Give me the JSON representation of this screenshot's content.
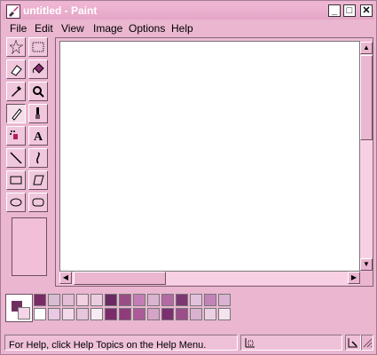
{
  "window": {
    "title": "untitled - Paint",
    "buttons": {
      "minimize": "_",
      "maximize": "□",
      "close": "✕"
    }
  },
  "menu": [
    "File",
    "Edit",
    "View",
    "Image",
    "Options",
    "Help"
  ],
  "tools": [
    {
      "name": "free-form-select-tool",
      "icon": "star-select-icon"
    },
    {
      "name": "select-tool",
      "icon": "rectangle-select-icon"
    },
    {
      "name": "eraser-tool",
      "icon": "eraser-icon"
    },
    {
      "name": "fill-tool",
      "icon": "paint-bucket-icon"
    },
    {
      "name": "pick-color-tool",
      "icon": "eyedropper-icon"
    },
    {
      "name": "magnifier-tool",
      "icon": "magnifier-icon"
    },
    {
      "name": "pencil-tool",
      "icon": "pencil-icon",
      "selected": true
    },
    {
      "name": "brush-tool",
      "icon": "brush-icon"
    },
    {
      "name": "airbrush-tool",
      "icon": "airbrush-icon"
    },
    {
      "name": "text-tool",
      "icon": "text-icon"
    },
    {
      "name": "line-tool",
      "icon": "line-icon"
    },
    {
      "name": "curve-tool",
      "icon": "curve-icon"
    },
    {
      "name": "rectangle-tool",
      "icon": "rectangle-icon"
    },
    {
      "name": "polygon-tool",
      "icon": "polygon-icon"
    },
    {
      "name": "ellipse-tool",
      "icon": "ellipse-icon"
    },
    {
      "name": "rounded-rectangle-tool",
      "icon": "rounded-rectangle-icon"
    }
  ],
  "palette": {
    "foreground": "#70305f",
    "background": "#f4d4e6",
    "row1": [
      "#7b2a68",
      "#d9bcd1",
      "#e4bdd6",
      "#f0d0e1",
      "#eacee0",
      "#6a2a62",
      "#9a4d85",
      "#c57eb5",
      "#dab4d0",
      "#b36aa4",
      "#7d3773",
      "#e2c1dc",
      "#c283b8",
      "#dbb2d1"
    ],
    "row2": [
      "#ffffff",
      "#e9c9e3",
      "#f3daea",
      "#e6c6dd",
      "#f7ecf3",
      "#7c2b6c",
      "#8f3b7c",
      "#ad5a98",
      "#d5a4c8",
      "#7b2e70",
      "#9c4d8a",
      "#d8b2cf",
      "#ebd0e2",
      "#f4e4ef"
    ]
  },
  "status": {
    "help": "For Help, click Help Topics on the Help Menu."
  }
}
